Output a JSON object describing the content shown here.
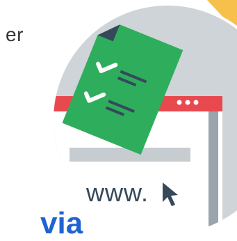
{
  "fragments": {
    "top_left_text": "er",
    "bottom_text": "via"
  },
  "browser": {
    "url_text": "www."
  },
  "colors": {
    "circle": "#cfd4d8",
    "browser_bar": "#e8494f",
    "document": "#2eae5c",
    "corner_tab": "#f7c04a",
    "dark": "#35495a",
    "bottom_text": "#1f63d1"
  }
}
